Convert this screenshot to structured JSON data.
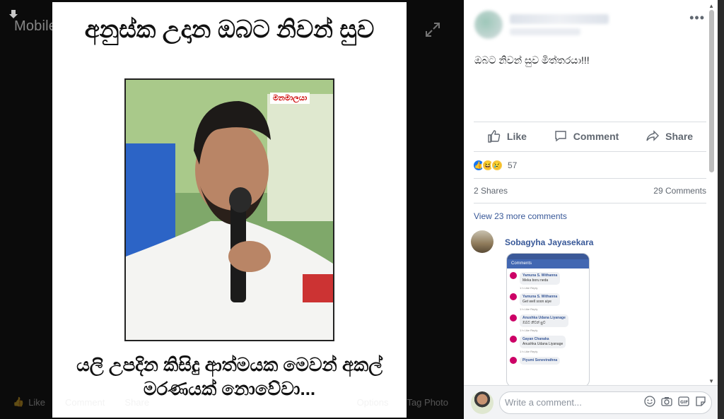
{
  "viewer": {
    "album_title": "Mobile Uploads",
    "icons": [
      "download-icon",
      "expand-icon"
    ],
    "poster": {
      "header": "අනුස්ක උදාන ඔබට නිවන් සුව",
      "watermark": "මනමාලයා",
      "footer_line1": "යලි උපදින කිසිදු ආත්මයක මෙවන් අකල්",
      "footer_line2": "මරණයක් නොවේවා..."
    },
    "bottom_bar": {
      "like": "Like",
      "comment": "Comment",
      "share": "Share",
      "options": "Options",
      "tag": "Tag Photo"
    }
  },
  "post": {
    "caption": "ඔබට නිවන් සුව මිත්තරයා!!!",
    "more": "•••",
    "actions": {
      "like": "Like",
      "comment": "Comment",
      "share": "Share"
    },
    "reactions": {
      "icons": [
        "like-icon",
        "haha-icon",
        "sad-icon"
      ],
      "count": "57"
    },
    "shares": "2 Shares",
    "comments_count": "29 Comments",
    "view_more": "View 23 more comments",
    "comment": {
      "author": "Sobagyha Jayasekara",
      "screenshot": {
        "header": "Comments",
        "rows": [
          {
            "name": "Yamuna S. Withanna",
            "text": "Meka boru neda"
          },
          {
            "name": "Yamuna S. Withanna",
            "text": "Get well soon aiye"
          },
          {
            "name": "Anushka Udana Liyanage",
            "text": "ඔබට නිවන් සුව"
          },
          {
            "name": "Gayan Chanaka",
            "text": "Anushka Udana Liyanage"
          },
          {
            "name": "Piyumi Senevirathna",
            "text": ""
          }
        ],
        "meta": "1 h   Like   Reply"
      }
    },
    "composer_placeholder": "Write a comment...",
    "composer_icons": [
      "emoji-icon",
      "camera-icon",
      "gif-icon",
      "sticker-icon"
    ]
  },
  "colors": {
    "fb_blue": "#385898",
    "link_blue": "#1877f2",
    "text_grey": "#606770"
  }
}
